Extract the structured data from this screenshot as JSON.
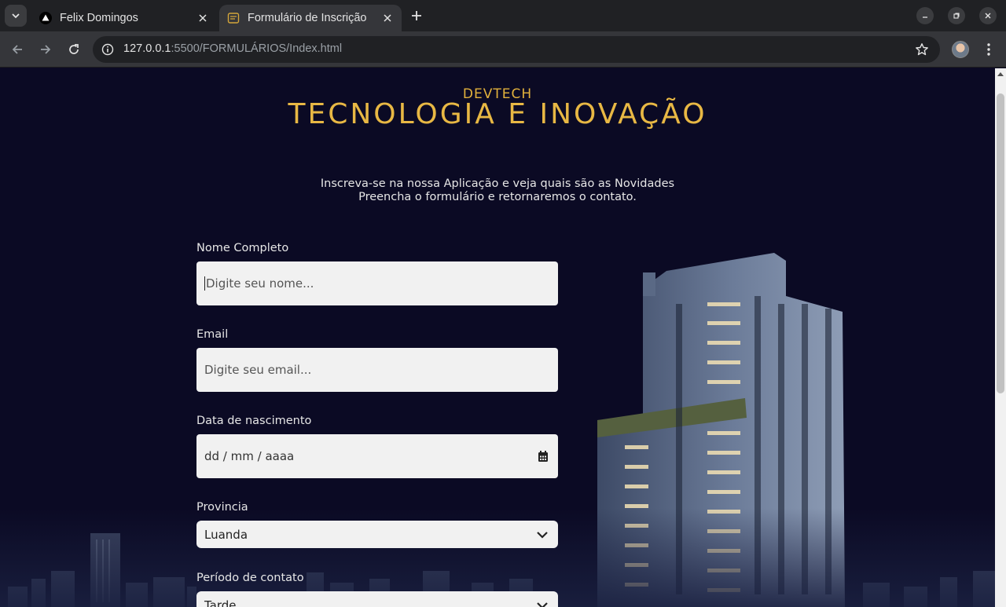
{
  "browser": {
    "tabs": [
      {
        "title": "Felix Domingos",
        "active": false
      },
      {
        "title": "Formulário de Inscrição",
        "active": true
      }
    ],
    "url_host": "127.0.0.1",
    "url_rest": ":5500/FORMULÁRIOS/Index.html"
  },
  "page": {
    "brand_small": "DEVTECH",
    "brand_title": "TECNOLOGIA E INOVAÇÃO",
    "intro_line1": "Inscreva-se na nossa Aplicação e veja quais são as Novidades",
    "intro_line2": "Preencha o formulário e retornaremos o contato.",
    "form": {
      "name_label": "Nome Completo",
      "name_placeholder": "Digite seu nome...",
      "email_label": "Email",
      "email_placeholder": "Digite seu email...",
      "birth_label": "Data de nascimento",
      "birth_placeholder": "dd / mm / aaaa",
      "province_label": "Provincia",
      "province_value": "Luanda",
      "contact_label": "Período de contato",
      "contact_value": "Tarde"
    }
  },
  "colors": {
    "background": "#0b0a24",
    "accent": "#e8b844",
    "field_bg": "#f1f1f1"
  }
}
